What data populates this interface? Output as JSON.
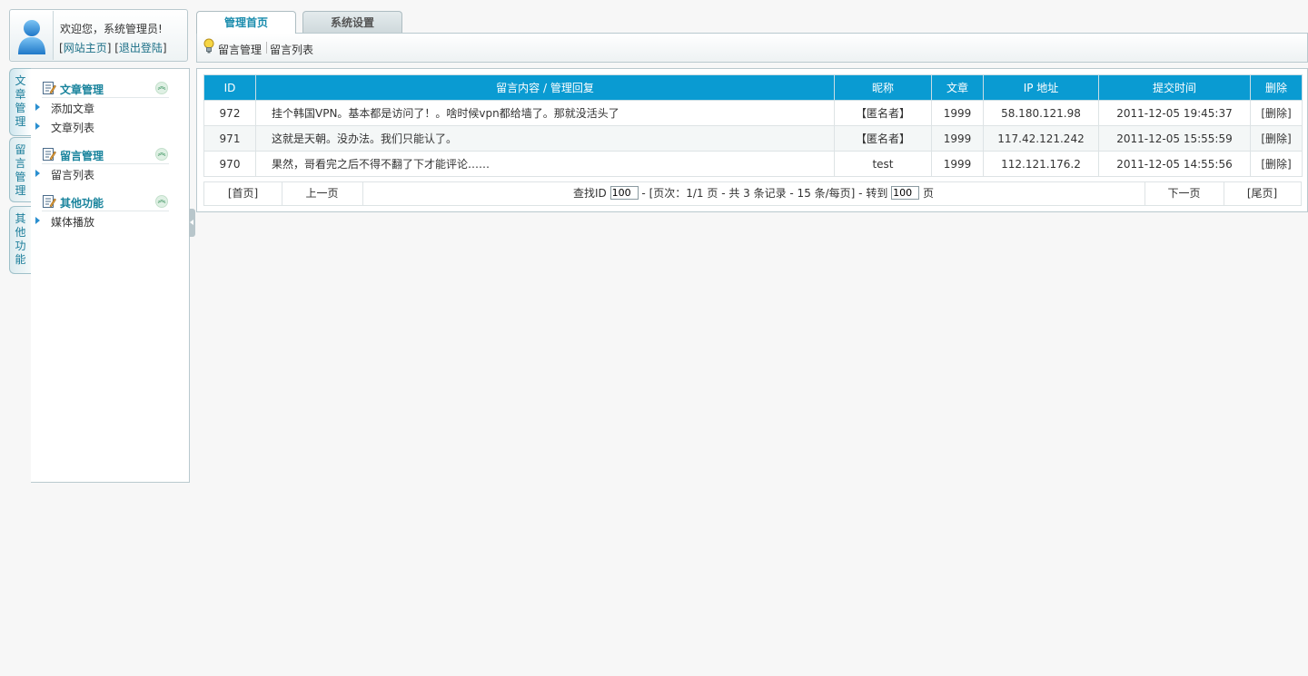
{
  "user": {
    "welcome": "欢迎您，系统管理员!",
    "site_home": "网站主页",
    "logout": "退出登陆"
  },
  "side_tabs": [
    "文章管理",
    "留言管理",
    "其他功能"
  ],
  "top_tabs": [
    "管理首页",
    "系统设置"
  ],
  "breadcrumb": [
    "留言管理",
    "留言列表"
  ],
  "menu": {
    "groups": [
      {
        "title": "文章管理",
        "items": [
          "添加文章",
          "文章列表"
        ]
      },
      {
        "title": "留言管理",
        "items": [
          "留言列表"
        ]
      },
      {
        "title": "其他功能",
        "items": [
          "媒体播放"
        ]
      }
    ]
  },
  "table": {
    "headers": [
      "ID",
      "留言内容 / 管理回复",
      "昵称",
      "文章",
      "IP 地址",
      "提交时间",
      "删除"
    ],
    "rows": [
      [
        "972",
        "挂个韩国VPN。基本都是访问了！。啥时候vpn都给墙了。那就没活头了",
        "【匿名者】",
        "1999",
        "58.180.121.98",
        "2011-12-05 19:45:37",
        "[删除]"
      ],
      [
        "971",
        "这就是天朝。没办法。我们只能认了。",
        "【匿名者】",
        "1999",
        "117.42.121.242",
        "2011-12-05 15:55:59",
        "[删除]"
      ],
      [
        "970",
        "果然，哥看完之后不得不翻了下才能评论……",
        "test",
        "1999",
        "112.121.176.2",
        "2011-12-05 14:55:56",
        "[删除]"
      ]
    ]
  },
  "pager": {
    "first": "[首页]",
    "prev": "上一页",
    "find_label": "查找ID",
    "find_value": "100",
    "info": "- [页次：1/1 页 - 共 3 条记录 - 15 条/每页] - 转到",
    "goto_value": "100",
    "page_unit": "页",
    "next": "下一页",
    "last": "[尾页]"
  },
  "colors": {
    "header_blue": "#0a9bd2",
    "menu_title": "#18839c",
    "side_tab_text": "#1a7d9a"
  }
}
